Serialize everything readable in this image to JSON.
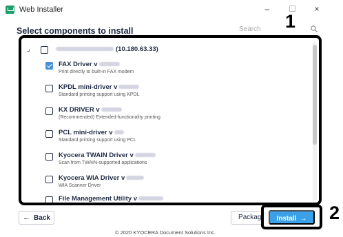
{
  "window": {
    "title": "Web Installer",
    "minimize_glyph": "–",
    "close_glyph": "×"
  },
  "header": {
    "section_title": "Select components to install",
    "search_label": "Search"
  },
  "group": {
    "collapse_glyph": "⌟",
    "host_suffix": "(10.180.63.33)",
    "checked": false
  },
  "components": [
    {
      "name": "FAX Driver v",
      "description": "Print directly to built-in FAX modem",
      "checked": true
    },
    {
      "name": "KPDL mini-driver v",
      "description": "Standard printing support using KPDL",
      "checked": false
    },
    {
      "name": "KX DRIVER v",
      "description": "(Recommended) Extended-functionality printing",
      "checked": false
    },
    {
      "name": "PCL mini-driver v",
      "description": "Standard printing support using PCL",
      "checked": false
    },
    {
      "name": "Kyocera TWAIN Driver v",
      "description": "Scan from TWAIN-supported applications",
      "checked": false
    },
    {
      "name": "Kyocera WIA Driver v",
      "description": "WIA Scanner Driver",
      "checked": false
    },
    {
      "name": "File Management Utility v",
      "description": "",
      "checked": false
    }
  ],
  "footer_bar": {
    "back_label": "Back",
    "back_arrow": "←",
    "package_label": "Package",
    "install_label": "Install",
    "install_arrow": "→"
  },
  "callouts": {
    "one": "1",
    "two": "2"
  },
  "copyright": "© 2020 KYOCERA Document Solutions Inc.",
  "colors": {
    "accent": "#3aa0e8",
    "checkbox_checked": "#4a90d9",
    "app_icon": "#1f9d6b",
    "text_dark": "#1f2a44"
  }
}
